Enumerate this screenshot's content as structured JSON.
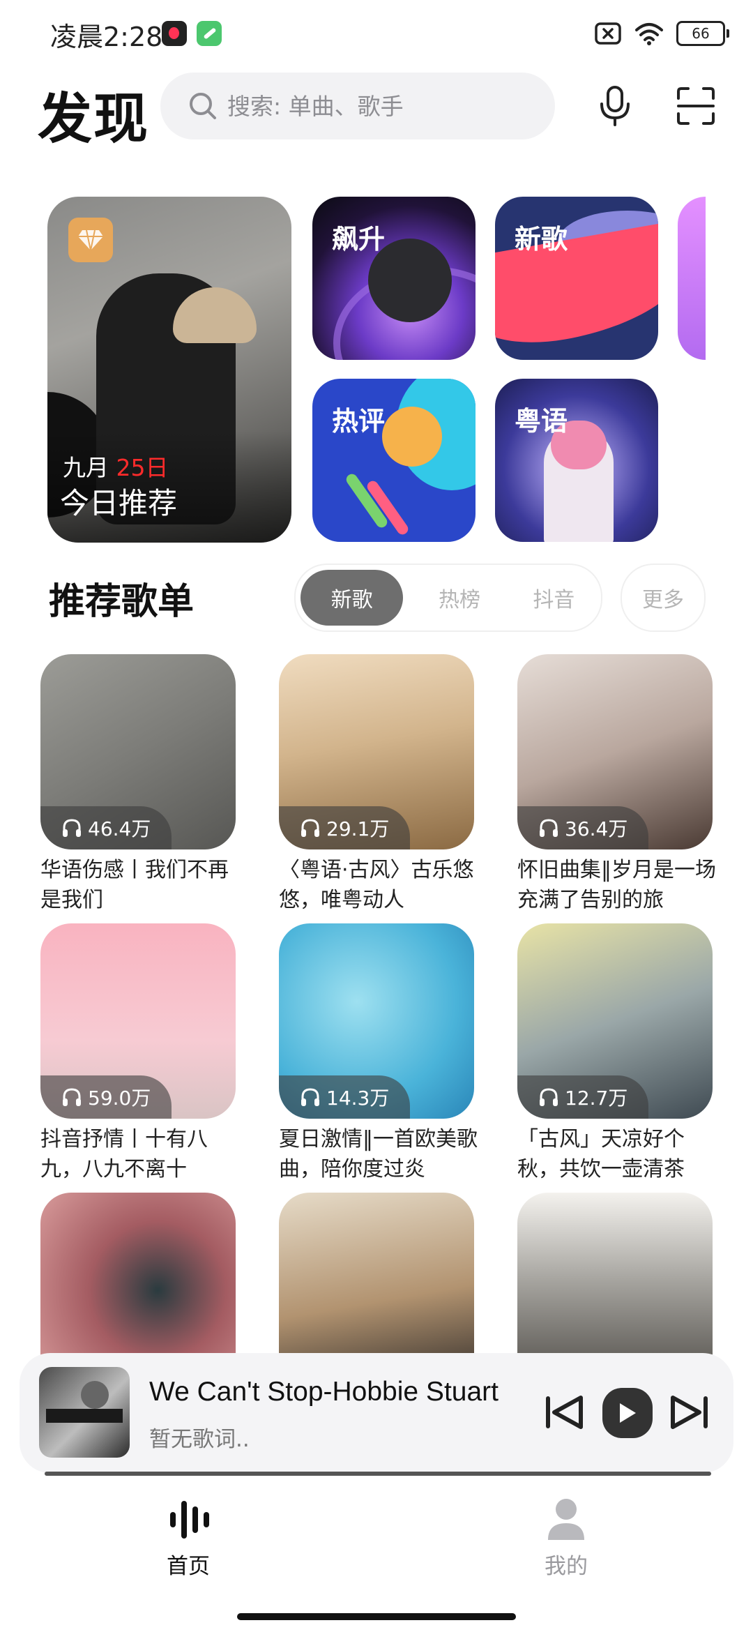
{
  "status_bar": {
    "time": "凌晨2:28",
    "battery": "66",
    "icons": [
      "music-app-icon",
      "tool-app-icon",
      "sim-off-icon",
      "wifi-icon",
      "battery-icon"
    ]
  },
  "header": {
    "title": "发现",
    "search_placeholder": "搜索: 单曲、歌手",
    "icons": [
      "search-icon",
      "microphone-icon",
      "scan-icon"
    ]
  },
  "featured": {
    "daily": {
      "month": "九月",
      "day": "25日",
      "label": "今日推荐"
    },
    "tiles": [
      {
        "label": "飙升"
      },
      {
        "label": "新歌"
      },
      {
        "label": "热评"
      },
      {
        "label": "粤语"
      }
    ]
  },
  "playlists_section": {
    "title": "推荐歌单",
    "tabs": [
      "新歌",
      "热榜",
      "抖音"
    ],
    "active_tab": 0,
    "more": "更多"
  },
  "playlists": [
    {
      "plays": "46.4万",
      "title": "华语伤感丨我们不再是我们"
    },
    {
      "plays": "29.1万",
      "title": "〈粤语·古风〉古乐悠悠，唯粤动人"
    },
    {
      "plays": "36.4万",
      "title": "怀旧曲集‖岁月是一场充满了告别的旅"
    },
    {
      "plays": "59.0万",
      "title": "抖音抒情丨十有八九，八九不离十"
    },
    {
      "plays": "14.3万",
      "title": "夏日激情‖一首欧美歌曲，陪你度过炎"
    },
    {
      "plays": "12.7万",
      "title": "「古风」天凉好个秋，共饮一壶清茶"
    },
    {
      "plays": "",
      "title": ""
    },
    {
      "plays": "",
      "title": ""
    },
    {
      "plays": "",
      "title": ""
    }
  ],
  "player": {
    "song": "We Can't Stop-Hobbie Stuart",
    "lyrics": "暂无歌词..",
    "progress": 1.0
  },
  "bottom_nav": {
    "items": [
      {
        "label": "首页",
        "icon": "waveform-icon",
        "active": true
      },
      {
        "label": "我的",
        "icon": "profile-icon",
        "active": false
      }
    ]
  },
  "colors": {
    "accent_red": "#ff2b2b",
    "tab_active_bg": "#6e6e6e",
    "search_bg": "#f2f2f4"
  }
}
